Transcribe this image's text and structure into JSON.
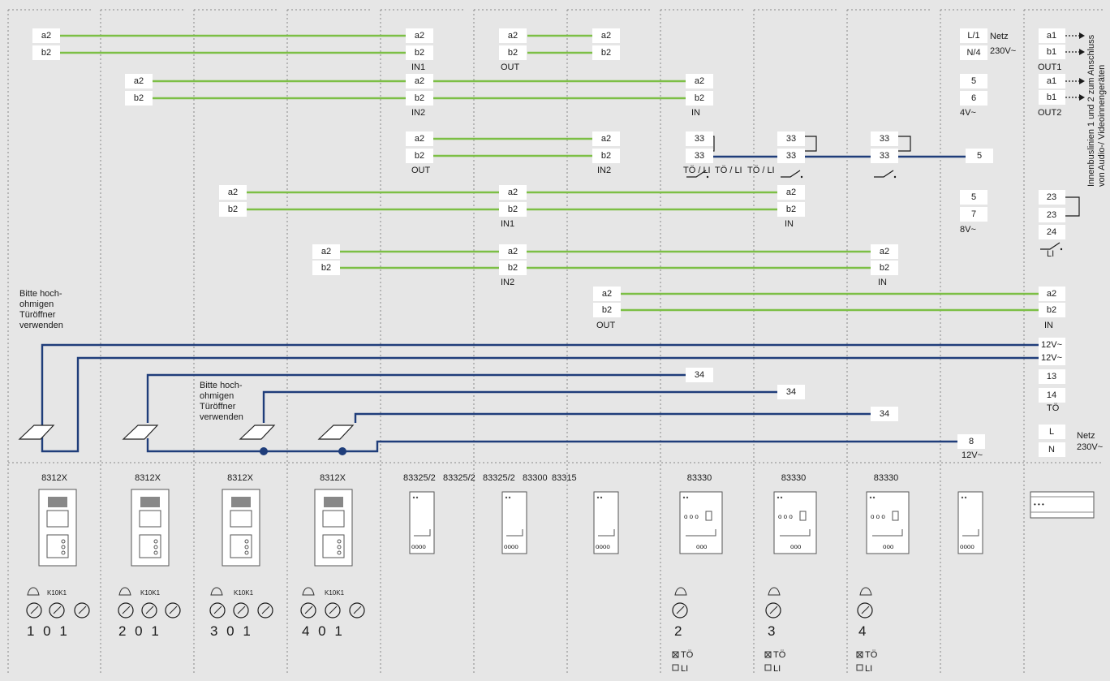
{
  "notes": {
    "left": [
      "Bitte hoch-",
      "ohmigen",
      "Türöffner",
      "verwenden"
    ],
    "mid": [
      "Bitte hoch-",
      "ohmigen",
      "Türöffner",
      "verwenden"
    ],
    "vertical": [
      "Innenbuslinien 1 und 2 zum Anschluss",
      "von Audio-/ Videoinnengeräten"
    ]
  },
  "terminals": {
    "a2": "a2",
    "b2": "b2",
    "a1": "a1",
    "b1": "b1",
    "t33": "33",
    "t34": "34",
    "t5": "5",
    "t6": "6",
    "t7": "7",
    "t8": "8",
    "t23": "23",
    "t24": "24",
    "t13": "13",
    "t14": "14",
    "L1": "L/1",
    "N4": "N/4",
    "L": "L",
    "N": "N"
  },
  "labels": {
    "IN1": "IN1",
    "IN2": "IN2",
    "IN": "IN",
    "OUT": "OUT",
    "OUT1": "OUT1",
    "OUT2": "OUT2",
    "to_li": "TÖ / LI",
    "v4": "4V~",
    "v8": "8V~",
    "v12": "12V~",
    "netz": "Netz",
    "v230": "230V~",
    "LI": "LI",
    "TO": "TÖ",
    "v12pwr": "12V~"
  },
  "devices": {
    "d1": "8312X",
    "d5": "83325/2",
    "d6": "83325/2",
    "d7": "83325/2",
    "d8": "83300",
    "d9": "83315",
    "d10": "83330"
  },
  "bells": {
    "k10k1": "K10K1",
    "n101": "1 0 1",
    "n201": "2 0 1",
    "n301": "3 0 1",
    "n401": "4 0 1",
    "n2": "2",
    "n3": "3",
    "n4": "4",
    "chk_to": "TÖ",
    "chk_li": "LI"
  }
}
